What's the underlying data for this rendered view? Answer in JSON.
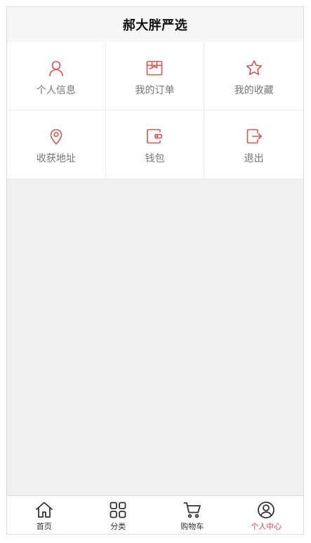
{
  "header": {
    "title": "郝大胖严选"
  },
  "menu": {
    "items": [
      {
        "label": "个人信息",
        "icon": "user-icon"
      },
      {
        "label": "我的订单",
        "icon": "order-box-icon"
      },
      {
        "label": "我的收藏",
        "icon": "star-icon"
      },
      {
        "label": "收获地址",
        "icon": "location-pin-icon"
      },
      {
        "label": "钱包",
        "icon": "wallet-icon"
      },
      {
        "label": "退出",
        "icon": "logout-icon"
      }
    ]
  },
  "tabbar": {
    "items": [
      {
        "label": "首页",
        "icon": "home-icon"
      },
      {
        "label": "分类",
        "icon": "category-grid-icon"
      },
      {
        "label": "购物车",
        "icon": "cart-icon"
      },
      {
        "label": "个人中心",
        "icon": "profile-circle-icon",
        "active": true
      }
    ]
  },
  "colors": {
    "accent": "#e0454f",
    "menu_icon": "#d9534f",
    "tab_icon": "#333333"
  }
}
